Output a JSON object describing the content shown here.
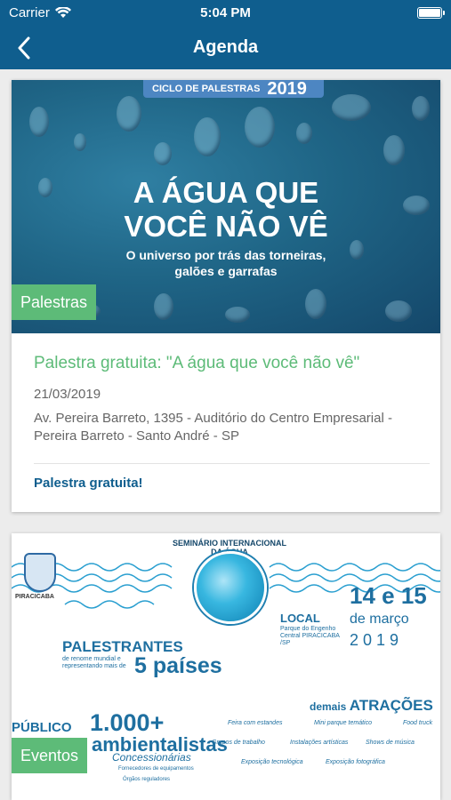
{
  "status_bar": {
    "carrier": "Carrier",
    "time": "5:04 PM"
  },
  "nav": {
    "title": "Agenda"
  },
  "events": [
    {
      "banner": {
        "ciclo": "CICLO DE PALESTRAS",
        "year": "2019",
        "headline_line1": "A ÁGUA QUE",
        "headline_line2": "VOCÊ NÃO VÊ",
        "sub_line1": "O universo por trás das torneiras,",
        "sub_line2": "galões e garrafas"
      },
      "category": "Palestras",
      "title": "Palestra gratuita: \"A água que você não vê\"",
      "date": "21/03/2019",
      "address": "Av. Pereira Barreto, 1395 - Auditório do Centro Empresarial - Pereira Barreto - Santo André - SP",
      "link": "Palestra gratuita!"
    },
    {
      "banner": {
        "crest_caption": "PIRACICABA",
        "seminar": "SEMINÁRIO INTERNACIONAL DA ÁGUA",
        "dates": "14 e 15",
        "month": "de março",
        "year": "2019",
        "local": "LOCAL",
        "local_detail": "Parque do Engenho Central PIRACICABA /SP",
        "palestrantes": "PALESTRANTES",
        "palestrantes_detail": "de renome mundial e representando mais de",
        "paises": "5 países",
        "demais": "demais",
        "atracoes": "ATRAÇÕES",
        "attractions": [
          "Feira com estandes",
          "Mini parque temático",
          "Food truck",
          "Grupos de trabalho",
          "Instalações artísticas",
          "Shows de música",
          "Exposição tecnológica",
          "Exposição fotográfica"
        ],
        "publico": "PÚBLICO",
        "publico_num": "1.000+",
        "ambientalistas": "ambientalistas",
        "concessionarias": "Concessionárias",
        "small1": "Fornecedores de equipamentos",
        "small2": "Órgãos reguladores"
      },
      "category": "Eventos"
    }
  ]
}
